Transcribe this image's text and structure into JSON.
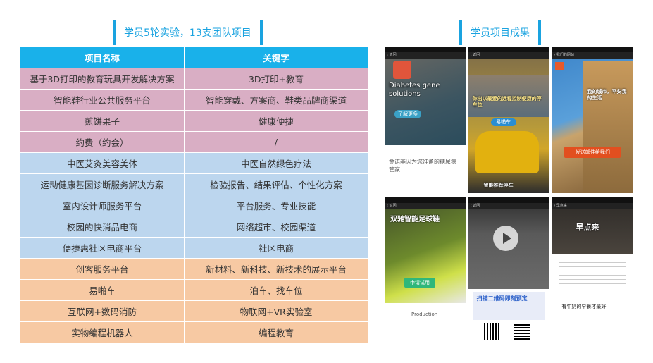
{
  "headings": {
    "left": "学员5轮实验，13支团队项目",
    "right": "学员项目成果"
  },
  "table": {
    "headers": [
      "项目名称",
      "关键字"
    ],
    "rows": [
      {
        "name": "基于3D打印的教育玩具开发解决方案",
        "keywords": "3D打印+教育",
        "group": "pink"
      },
      {
        "name": "智能鞋行业公共服务平台",
        "keywords": "智能穿戴、方案商、鞋类品牌商渠道",
        "group": "pink"
      },
      {
        "name": "煎饼果子",
        "keywords": "健康便捷",
        "group": "pink"
      },
      {
        "name": "约费（约会）",
        "keywords": "/",
        "group": "pink"
      },
      {
        "name": "中医艾灸美容美体",
        "keywords": "中医自然绿色疗法",
        "group": "blue"
      },
      {
        "name": "运动健康基因诊断服务解决方案",
        "keywords": "检验报告、结果评估、个性化方案",
        "group": "blue"
      },
      {
        "name": "室内设计师服务平台",
        "keywords": "平台服务、专业技能",
        "group": "blue"
      },
      {
        "name": "校园的快消品电商",
        "keywords": "网络超市、校园渠道",
        "group": "blue"
      },
      {
        "name": "便捷惠社区电商平台",
        "keywords": "社区电商",
        "group": "blue"
      },
      {
        "name": "创客服务平台",
        "keywords": "新材料、新科技、新技术的展示平台",
        "group": "orange"
      },
      {
        "name": "易啪车",
        "keywords": "泊车、找车位",
        "group": "orange"
      },
      {
        "name": "互联网+数码消防",
        "keywords": "物联网+VR实验室",
        "group": "orange"
      },
      {
        "name": "实物编程机器人",
        "keywords": "编程教育",
        "group": "orange"
      }
    ]
  },
  "shots": {
    "s1": {
      "title": "Diabetes gene solutions",
      "button": "了解更多",
      "caption": "金诺基因为您准备的糖尿病管家"
    },
    "s2": {
      "headline": "你出以最爱的远程控制便捷的停车位",
      "button": "易啪车",
      "footer": "智能推荐停车"
    },
    "s3": {
      "headline": "我的城市，平安我的生活",
      "button": "发送邮件给我们"
    },
    "s4": {
      "title": "双驰智能足球鞋",
      "button": "申请试用",
      "caption": "Production"
    },
    "s5": {
      "headline": "扫描二维码即刻预定"
    },
    "s6": {
      "title": "早点来",
      "caption": "有牛奶的早餐才最好"
    }
  },
  "colors": {
    "accent": "#1aa3e0",
    "header": "#19b1ea",
    "pink": "#d9aec4",
    "blue": "#bcd6ee",
    "orange": "#f7c9a3"
  }
}
